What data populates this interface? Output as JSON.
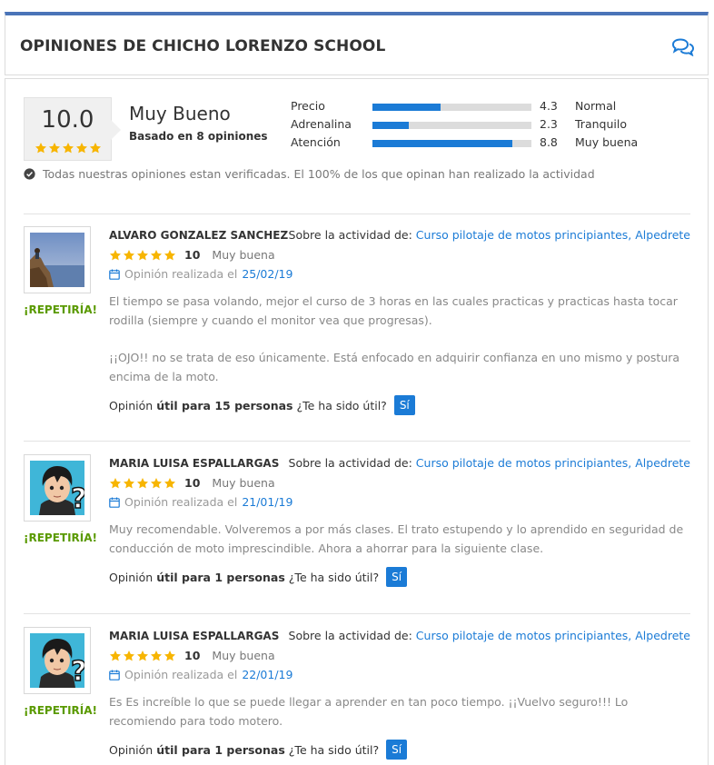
{
  "header": {
    "title": "OPINIONES DE CHICHO LORENZO SCHOOL",
    "icon": "comments-icon",
    "accent_color": "#4a74b8"
  },
  "summary": {
    "score": "10.0",
    "stars": 5,
    "label": "Muy Bueno",
    "based_on": "Basado en 8 opiniones",
    "categories": [
      {
        "name": "Precio",
        "value": "4.3",
        "fill": 0.43,
        "word": "Normal"
      },
      {
        "name": "Adrenalina",
        "value": "2.3",
        "fill": 0.23,
        "word": "Tranquilo"
      },
      {
        "name": "Atención",
        "value": "8.8",
        "fill": 0.88,
        "word": "Muy buena"
      }
    ],
    "verified_text": "Todas nuestras opiniones estan verificadas. El 100% de los que opinan han realizado la actividad",
    "bar_color": "#1b7bd6"
  },
  "reviews": [
    {
      "name": "ALVARO GONZALEZ SANCHEZ",
      "avatar": "photo-avatar",
      "activity_label": "Sobre la actividad de:",
      "activity_link": "Curso pilotaje de motos principiantes, Alpedrete",
      "stars": 5,
      "score": "10",
      "score_word": "Muy buena",
      "date_label": "Opinión realizada el",
      "date": "25/02/19",
      "repeat": "¡REPETIRÍA!",
      "text_1": "El tiempo se pasa volando, mejor el curso de 3 horas en las cuales practicas y practicas hasta tocar rodilla (siempre y cuando el monitor vea que progresas).",
      "text_2": "¡¡OJO!! no se trata de eso únicamente. Está enfocado en adquirir confianza en uno mismo y postura encima de la moto.",
      "helpful_prefix": "Opinión",
      "helpful_bold": "útil para 15 personas",
      "helpful_question": "¿Te ha sido útil?",
      "yes_label": "Sí"
    },
    {
      "name": "MARIA LUISA ESPALLARGAS",
      "avatar": "cartoon-avatar",
      "activity_label": "Sobre la actividad de:",
      "activity_link": "Curso pilotaje de motos principiantes, Alpedrete",
      "stars": 5,
      "score": "10",
      "score_word": "Muy buena",
      "date_label": "Opinión realizada el",
      "date": "21/01/19",
      "repeat": "¡REPETIRÍA!",
      "text_1": "Muy recomendable. Volveremos a por más clases. El trato estupendo y lo aprendido en seguridad de conducción de moto imprescindible. Ahora a ahorrar para la siguiente clase.",
      "helpful_prefix": "Opinión",
      "helpful_bold": "útil para 1 personas",
      "helpful_question": "¿Te ha sido útil?",
      "yes_label": "Sí"
    },
    {
      "name": "MARIA LUISA ESPALLARGAS",
      "avatar": "cartoon-avatar",
      "activity_label": "Sobre la actividad de:",
      "activity_link": "Curso pilotaje de motos principiantes, Alpedrete",
      "stars": 5,
      "score": "10",
      "score_word": "Muy buena",
      "date_label": "Opinión realizada el",
      "date": "22/01/19",
      "repeat": "¡REPETIRÍA!",
      "text_1": "Es Es increíble lo que se puede llegar a aprender en tan poco tiempo. ¡¡Vuelvo seguro!!! Lo recomiendo para todo motero.",
      "helpful_prefix": "Opinión",
      "helpful_bold": "útil para 1 personas",
      "helpful_question": "¿Te ha sido útil?",
      "yes_label": "Sí"
    }
  ]
}
